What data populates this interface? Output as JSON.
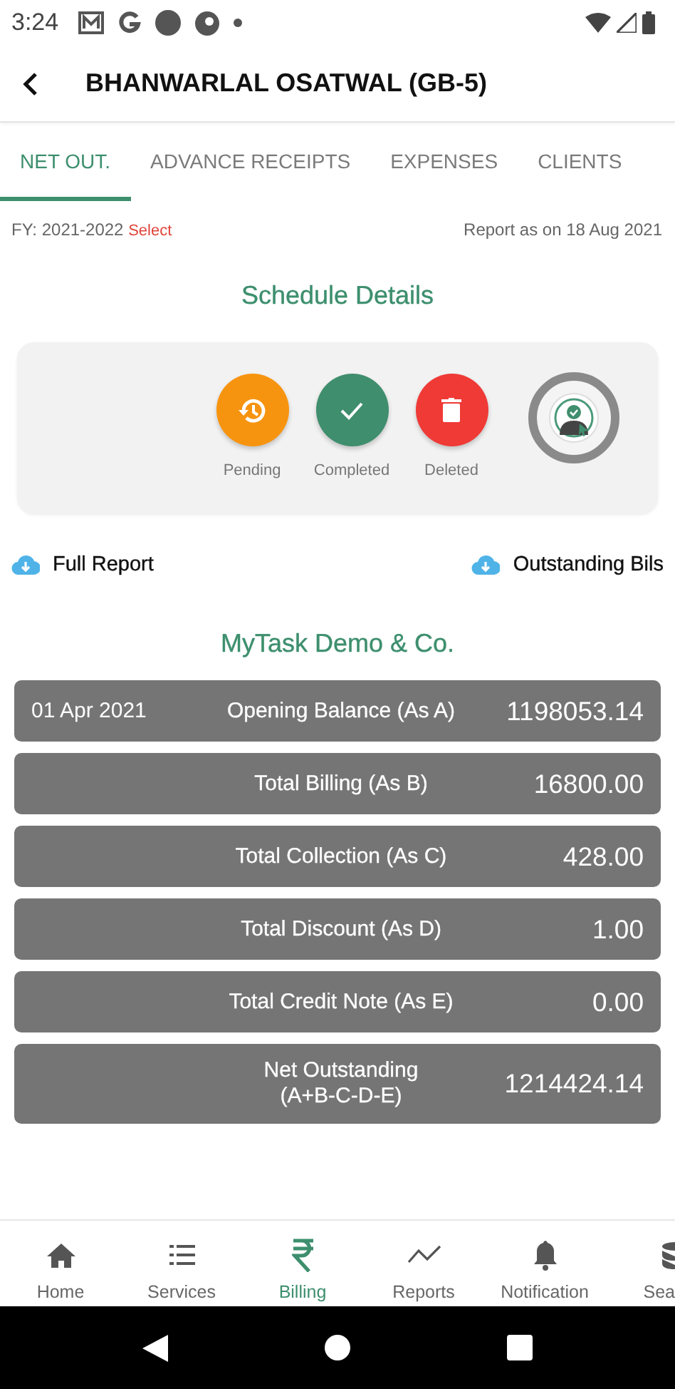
{
  "status_bar": {
    "time": "3:24"
  },
  "app_bar": {
    "title": "BHANWARLAL OSATWAL (GB-5)"
  },
  "tabs": [
    {
      "label": "NET OUT.",
      "selected": true
    },
    {
      "label": "ADVANCE RECEIPTS",
      "selected": false
    },
    {
      "label": "EXPENSES",
      "selected": false
    },
    {
      "label": "CLIENTS",
      "selected": false
    }
  ],
  "fy": {
    "label": "FY: 2021-2022",
    "link": "Select",
    "report_date": "Report as on 18 Aug 2021"
  },
  "schedule": {
    "title": "Schedule Details",
    "buttons": [
      {
        "kind": "pending",
        "label": "Pending"
      },
      {
        "kind": "completed",
        "label": "Completed"
      },
      {
        "kind": "deleted",
        "label": "Deleted"
      }
    ]
  },
  "downloads": [
    {
      "label": "Full Report"
    },
    {
      "label": "Outstanding Bils"
    }
  ],
  "company": "MyTask Demo & Co.",
  "summary": [
    {
      "date": "01 Apr 2021",
      "label": "Opening Balance (As A)",
      "value": "1198053.14"
    },
    {
      "label": "Total Billing (As B)",
      "value": "16800.00"
    },
    {
      "label": "Total Collection (As C)",
      "value": "428.00"
    },
    {
      "label": "Total Discount (As D)",
      "value": "1.00"
    },
    {
      "label": "Total Credit Note (As E)",
      "value": "0.00"
    },
    {
      "label": "Net Outstanding\n(A+B-C-D-E)",
      "value": "1214424.14"
    }
  ],
  "bottom_nav": [
    {
      "kind": "home",
      "label": "Home",
      "selected": false
    },
    {
      "kind": "services",
      "label": "Services",
      "selected": false
    },
    {
      "kind": "billing",
      "label": "Billing",
      "selected": true
    },
    {
      "kind": "reports",
      "label": "Reports",
      "selected": false
    },
    {
      "kind": "notification",
      "label": "Notification",
      "selected": false
    },
    {
      "kind": "search",
      "label": "Sea",
      "selected": false
    }
  ]
}
